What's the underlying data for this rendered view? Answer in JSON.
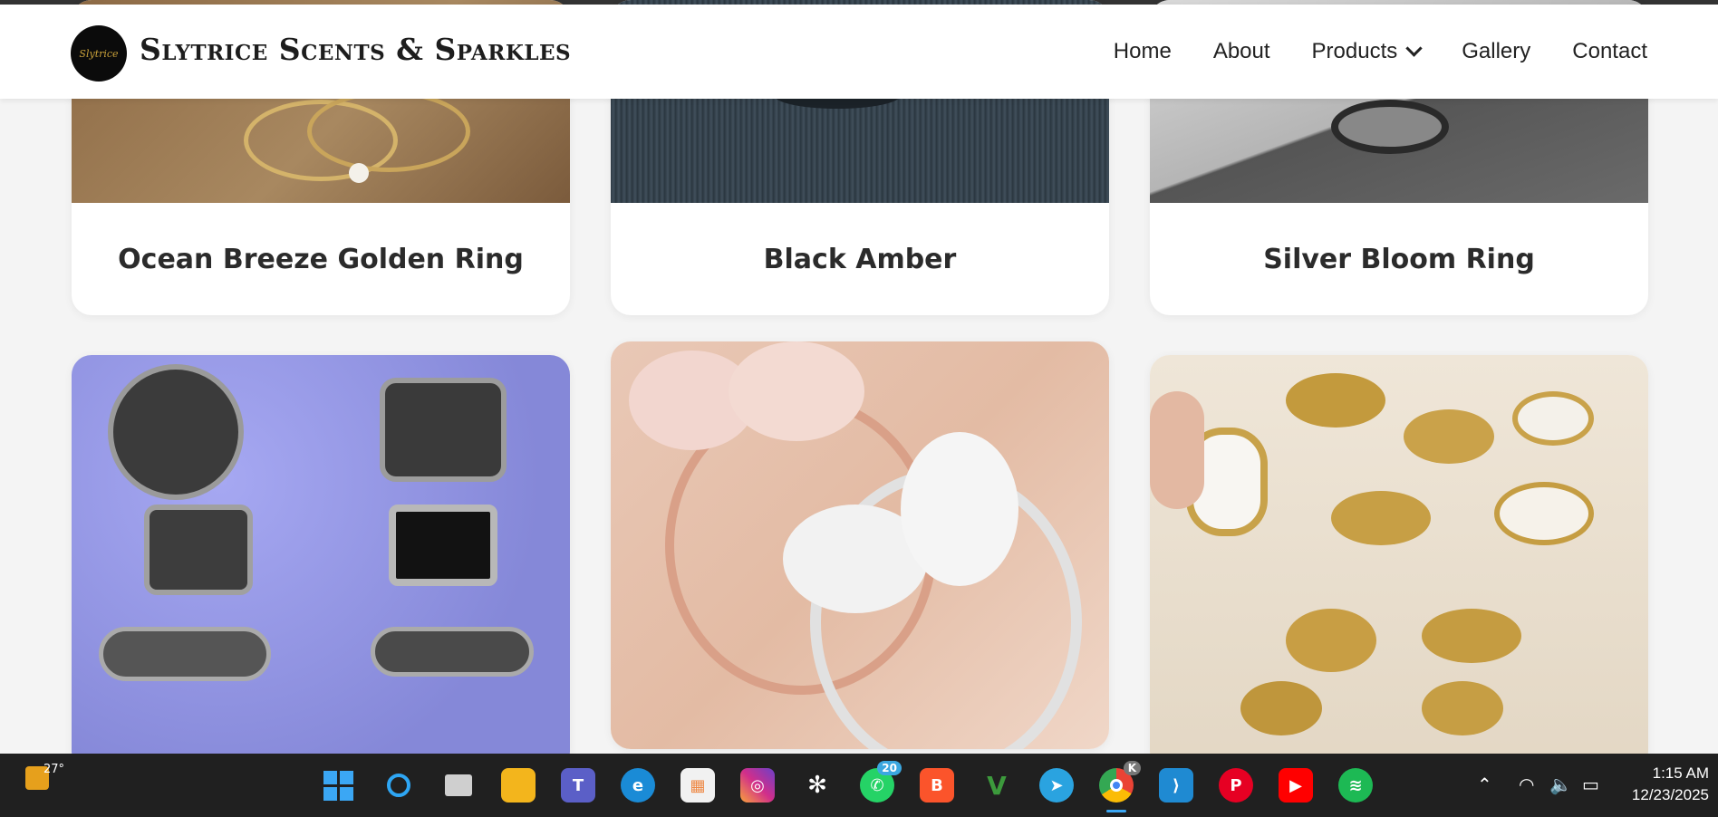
{
  "brand": {
    "name": "Slytrice Scents & Sparkles",
    "logo_text": "Slytrice"
  },
  "nav": {
    "items": [
      "Home",
      "About",
      "Products",
      "Gallery",
      "Contact"
    ]
  },
  "products": [
    {
      "title": "Ocean Breeze Golden Ring"
    },
    {
      "title": "Black Amber"
    },
    {
      "title": "Silver Bloom Ring"
    }
  ],
  "taskbar": {
    "weather": "27°",
    "whatsapp_badge": "20",
    "chrome_badge": "K",
    "time": "1:15 AM",
    "date": "12/23/2025",
    "icons": [
      "windows-start-icon",
      "search-icon",
      "task-view-icon",
      "file-explorer-icon",
      "teams-icon",
      "edge-icon",
      "store-icon",
      "instagram-icon",
      "chatgpt-icon",
      "whatsapp-icon",
      "brave-icon",
      "vim-icon",
      "telegram-icon",
      "chrome-icon",
      "vscode-icon",
      "pinterest-icon",
      "youtube-icon",
      "spotify-icon"
    ]
  }
}
